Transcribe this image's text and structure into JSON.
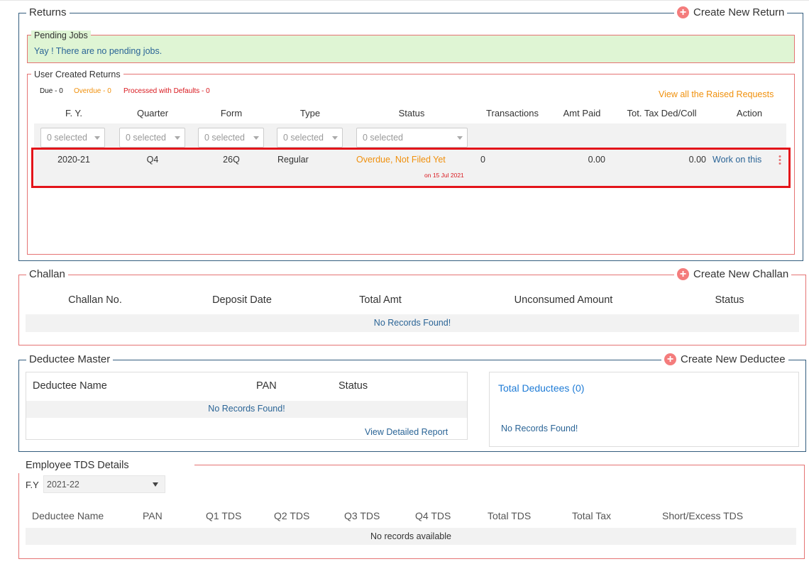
{
  "returns": {
    "title": "Returns",
    "create_label": "Create New Return",
    "pending": {
      "title": "Pending Jobs",
      "message": "Yay ! There are no pending jobs."
    },
    "user_created": {
      "title": "User Created Returns",
      "due": "Due - 0",
      "overdue": "Overdue - 0",
      "processed": "Processed with Defaults - 0",
      "raised_link": "View all the Raised Requests",
      "columns": [
        "F. Y.",
        "Quarter",
        "Form",
        "Type",
        "Status",
        "Transactions",
        "Amt Paid",
        "Tot. Tax Ded/Coll",
        "Action"
      ],
      "filters": [
        "0 selected",
        "0 selected",
        "0 selected",
        "0 selected",
        "0 selected"
      ],
      "row": {
        "fy": "2020-21",
        "quarter": "Q4",
        "form": "26Q",
        "type": "Regular",
        "status": "Overdue, Not Filed Yet",
        "status_date": "on 15 Jul 2021",
        "transactions": "0",
        "amt_paid": "0.00",
        "tot_tax": "0.00",
        "action": "Work on this"
      }
    }
  },
  "challan": {
    "title": "Challan",
    "create_label": "Create New Challan",
    "columns": [
      "Challan No.",
      "Deposit Date",
      "Total Amt",
      "Unconsumed Amount",
      "Status"
    ],
    "empty": "No Records Found!"
  },
  "deductee": {
    "title": "Deductee Master",
    "create_label": "Create New Deductee",
    "columns": [
      "Deductee Name",
      "PAN",
      "Status"
    ],
    "empty": "No Records Found!",
    "report_link": "View Detailed Report",
    "total_label": "Total Deductees (0)",
    "total_empty": "No Records Found!"
  },
  "employee": {
    "title": "Employee TDS Details",
    "fy_label": "F.Y",
    "fy_value": "2021-22",
    "columns": [
      "Deductee Name",
      "PAN",
      "Q1 TDS",
      "Q2 TDS",
      "Q3 TDS",
      "Q4 TDS",
      "Total TDS",
      "Total Tax",
      "Short/Excess TDS"
    ],
    "empty": "No records available"
  },
  "colors": {
    "accent_red": "#e57373",
    "highlight": "#e3141a",
    "overdue": "#f0900c",
    "processed": "#d9181e",
    "link": "#2a6496",
    "pending_bg": "#dff5d4"
  }
}
